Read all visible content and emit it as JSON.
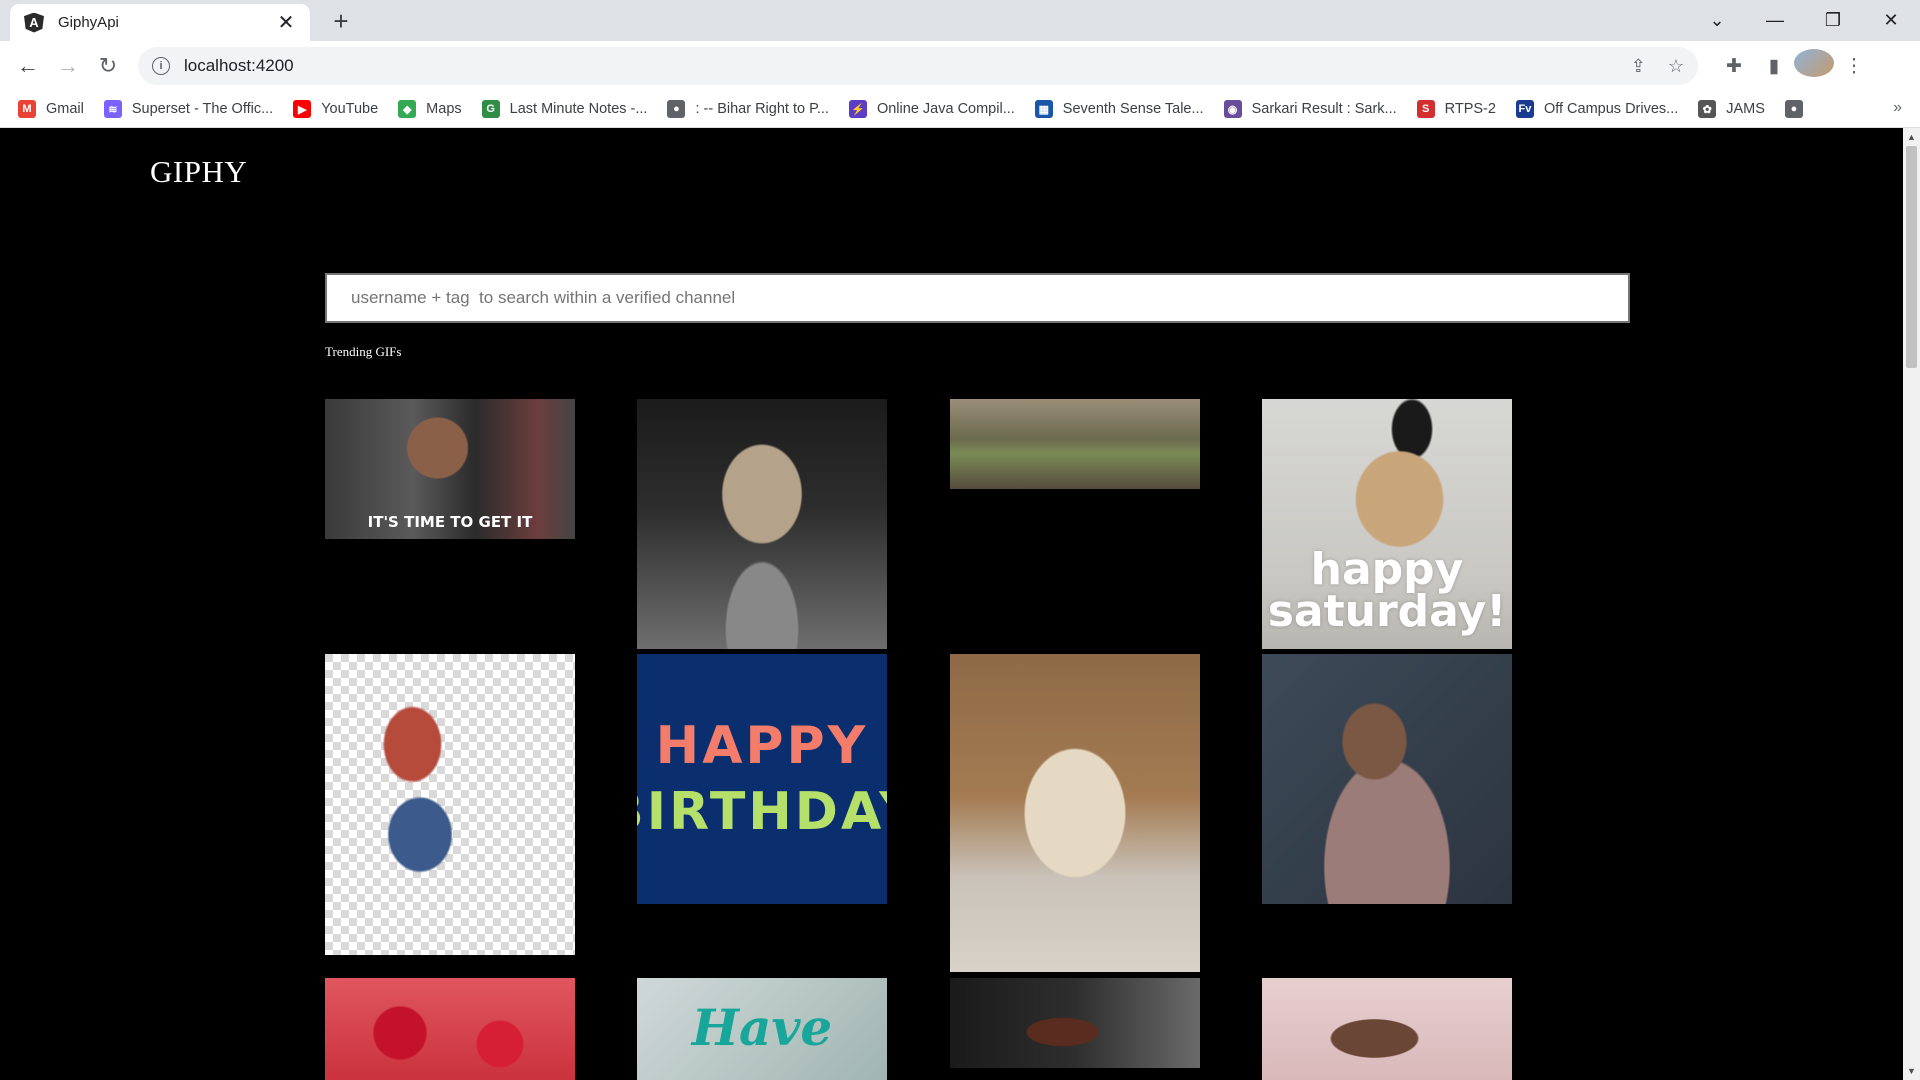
{
  "browser": {
    "tab_title": "GiphyApi",
    "tab_close": "✕",
    "new_tab": "+",
    "url": "localhost:4200",
    "window_controls": [
      "⌄",
      "—",
      "❐",
      "✕"
    ],
    "bookmarks": [
      {
        "label": "Gmail",
        "icon": "gmail-icon",
        "color": "#ea4335",
        "glyph": "M"
      },
      {
        "label": "Superset - The Offic...",
        "icon": "superset-icon",
        "color": "#7b61ff",
        "glyph": "≋"
      },
      {
        "label": "YouTube",
        "icon": "youtube-icon",
        "color": "#ff0000",
        "glyph": "▶"
      },
      {
        "label": "Maps",
        "icon": "maps-icon",
        "color": "#34a853",
        "glyph": "◆"
      },
      {
        "label": "Last Minute Notes -...",
        "icon": "gfg-icon",
        "color": "#2f8d46",
        "glyph": "G"
      },
      {
        "label": ": -- Bihar Right to P...",
        "icon": "globe-icon",
        "color": "#5f6368",
        "glyph": "●"
      },
      {
        "label": "Online Java Compil...",
        "icon": "jdoodle-icon",
        "color": "#5b3cc4",
        "glyph": "⚡"
      },
      {
        "label": "Seventh Sense Tale...",
        "icon": "seventh-sense-icon",
        "color": "#1a56a8",
        "glyph": "▦"
      },
      {
        "label": "Sarkari Result : Sark...",
        "icon": "sarkari-icon",
        "color": "#6a4c9c",
        "glyph": "◉"
      },
      {
        "label": "RTPS-2",
        "icon": "rtps-icon",
        "color": "#d32f2f",
        "glyph": "S"
      },
      {
        "label": "Off Campus Drives...",
        "icon": "fv-icon",
        "color": "#1a3b8f",
        "glyph": "Fv"
      },
      {
        "label": "JAMS",
        "icon": "jams-icon",
        "color": "#555555",
        "glyph": "✿"
      },
      {
        "label": "",
        "icon": "globe-icon",
        "color": "#5f6368",
        "glyph": "●"
      }
    ],
    "bookmarks_more": "»"
  },
  "page": {
    "logo": "GIPHY",
    "search_placeholder": "username + tag  to search within a verified channel",
    "section_title": "Trending GIFs",
    "gifs": [
      {
        "name": "gif-its-time-to-get-it",
        "caption": "IT'S TIME TO GET IT"
      },
      {
        "name": "gif-cat-motorcycle",
        "caption": ""
      },
      {
        "name": "gif-skateboard-road",
        "caption": ""
      },
      {
        "name": "gif-pug-happy-saturday",
        "caption": "happy saturday!"
      },
      {
        "name": "gif-karate-kick",
        "caption": ""
      },
      {
        "name": "gif-happy-birthday",
        "caption_line1": "HAPPY",
        "caption_line2": "BIRTHDAY"
      },
      {
        "name": "gif-dancing-bear",
        "caption": ""
      },
      {
        "name": "gif-bearded-man",
        "caption": ""
      },
      {
        "name": "gif-red-hearts",
        "caption": ""
      },
      {
        "name": "gif-have-a",
        "caption": "Have"
      },
      {
        "name": "gif-dark-scene",
        "caption": ""
      },
      {
        "name": "gif-dog-bath",
        "caption": ""
      }
    ]
  }
}
